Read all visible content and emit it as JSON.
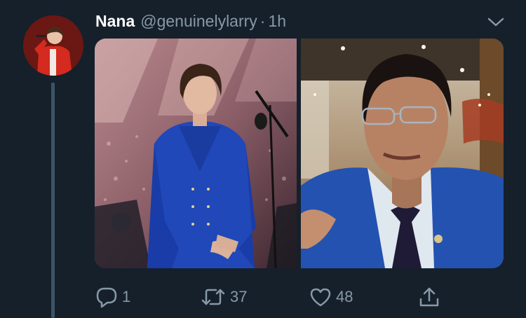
{
  "tweet": {
    "author_name": "Nana",
    "handle": "@genuinelylarry",
    "separator": "·",
    "time": "1h"
  },
  "actions": {
    "reply_count": "1",
    "retweet_count": "37",
    "like_count": "48"
  },
  "icons": {
    "reply": "speech-bubble-icon",
    "retweet": "retweet-arrows-icon",
    "like": "heart-icon",
    "share": "share-upload-icon",
    "menu": "chevron-down-icon"
  },
  "colors": {
    "background": "#15202b",
    "secondary_text": "#8899a6",
    "thread_line": "#3d5466"
  }
}
